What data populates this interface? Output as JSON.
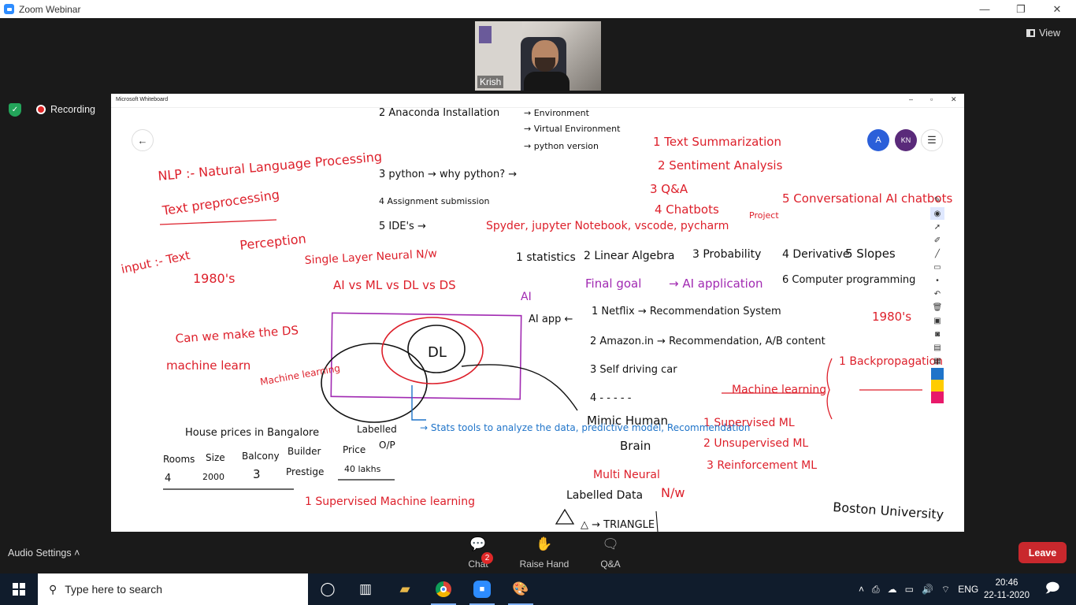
{
  "zoom": {
    "window_title": "Zoom Webinar",
    "view_label": "View",
    "participant_name": "Krish",
    "recording_label": "Recording",
    "audio_settings_label": "Audio Settings",
    "controls": [
      {
        "label": "Chat",
        "badge": "2"
      },
      {
        "label": "Raise Hand"
      },
      {
        "label": "Q&A"
      }
    ],
    "leave_label": "Leave"
  },
  "whiteboard": {
    "window_title": "Microsoft Whiteboard",
    "avatar_initial": "A",
    "avatar_kn": "KN",
    "ink": {
      "red": "#dd1f2a",
      "purple": "#a12ab2",
      "blue": "#1f74c9",
      "black": "#111111"
    },
    "notes": [
      "2 Anaconda Installation",
      "→ Environment",
      "→ Virtual Environment",
      "→ python version",
      "NLP :- Natural Language Processing",
      "Text preprocessing",
      "3 python → why python? →",
      "4 Assignment submission",
      "5 IDE's →",
      "Spyder, jupyter Notebook, vscode, pycharm",
      "Project",
      "1 Text Summarization",
      "2 Sentiment Analysis",
      "3 Q&A",
      "4 Chatbots",
      "5 Conversational AI chatbots",
      "input :- Text",
      "Perception",
      "Single Layer Neural N/w",
      "1980's",
      "AI vs ML vs DL vs DS",
      "1 statistics",
      "2 Linear Algebra",
      "3 Probability",
      "4 Derivative",
      "5 Slopes",
      "6 Computer programming",
      "Final goal",
      "→ AI application",
      "Can we make the DS",
      "machine learn",
      "Machine learning",
      "AI",
      "AI app ←",
      "1 Netflix → Recommendation System",
      "2 Amazon.in → Recommendation, A/B content",
      "3 Self driving car",
      "4 - - - - -",
      "1980's",
      "1 Backpropagation",
      "Machine learning",
      "Mimic Human",
      "Brain",
      "1 Supervised ML",
      "2 Unsupervised ML",
      "3 Reinforcement ML",
      "→ Stats tools to analyze the data, predictive model, Recommendation",
      "DL",
      "House prices in Bangalore",
      "Labelled",
      "O/P",
      "Rooms",
      "Size",
      "Balcony",
      "Builder",
      "Price",
      "4",
      "2000",
      "3",
      "Prestige",
      "40 lakhs",
      "1 Supervised Machine learning",
      "Multi Neural",
      "Labelled Data",
      "N/w",
      "△ → TRIANGLE",
      "Boston University"
    ]
  },
  "taskbar": {
    "search_placeholder": "Type here to search",
    "language": "ENG",
    "time": "20:46",
    "date": "22-11-2020"
  }
}
